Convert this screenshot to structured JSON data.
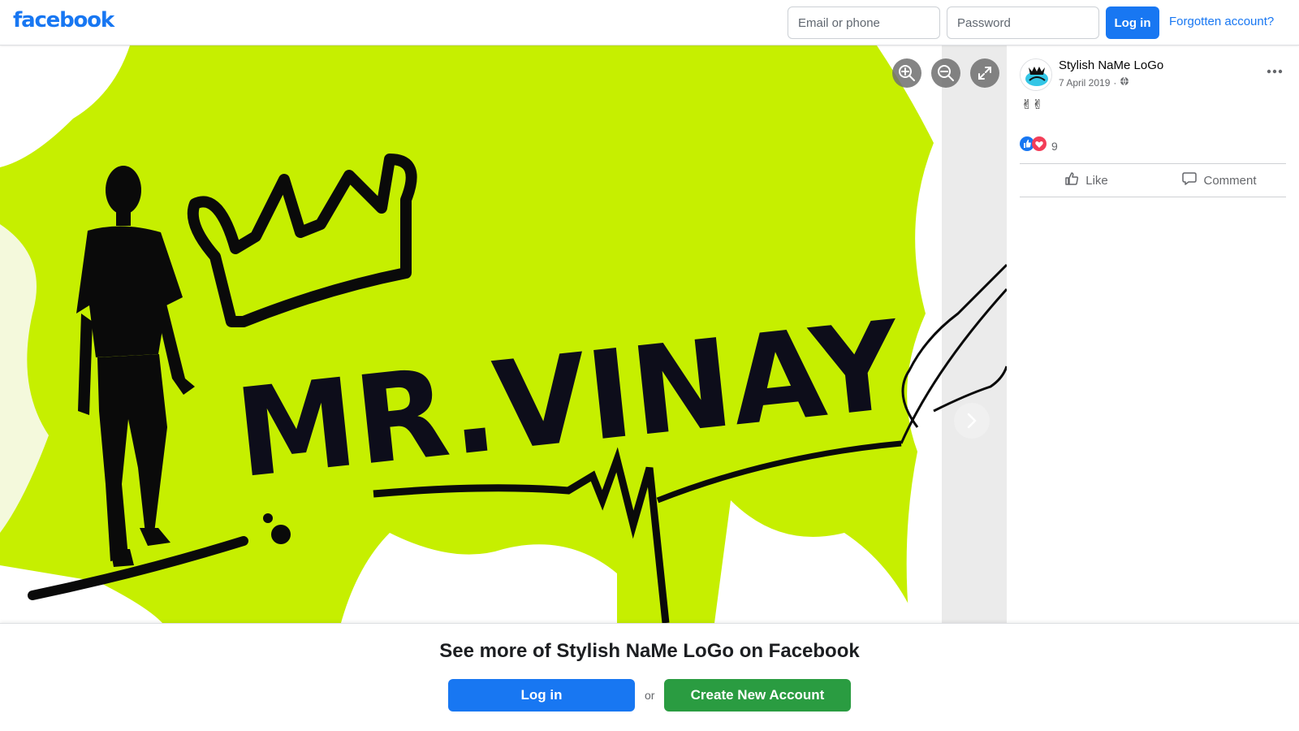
{
  "header": {
    "logo": "facebook",
    "email_placeholder": "Email or phone",
    "password_placeholder": "Password",
    "login_label": "Log in",
    "forgot_label": "Forgotten account?"
  },
  "photo": {
    "text": "MR.VINAY",
    "controls": [
      "zoom-in-icon",
      "zoom-out-icon",
      "fullscreen-icon"
    ],
    "next_icon": "chevron-right-icon"
  },
  "post": {
    "page_name": "Stylish NaMe LoGo",
    "date": "7 April 2019",
    "separator": "·",
    "privacy_icon": "globe-icon",
    "text": "✌✌",
    "reaction_count": "9",
    "like_label": "Like",
    "comment_label": "Comment"
  },
  "footer": {
    "title": "See more of Stylish NaMe LoGo on Facebook",
    "login_label": "Log in",
    "or_label": "or",
    "create_label": "Create New Account"
  },
  "colors": {
    "brand": "#1877f2",
    "create_green": "#2a9c41",
    "splash": "#c6ef00"
  }
}
